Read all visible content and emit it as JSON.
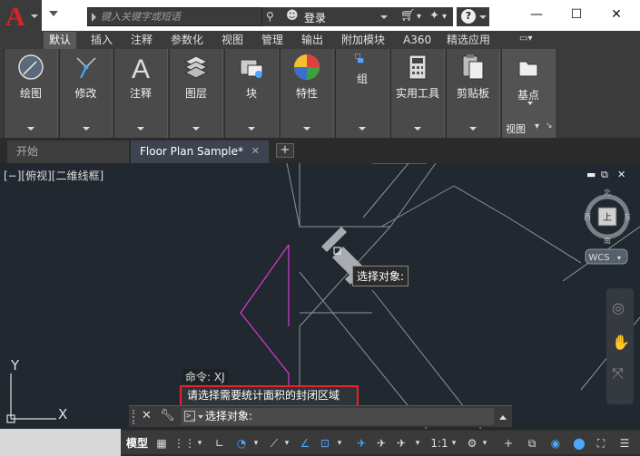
{
  "app": {
    "logo_letter": "A"
  },
  "search": {
    "placeholder": "键入关键字或短语"
  },
  "header": {
    "login_label": "登录"
  },
  "ribbon": {
    "tabs": [
      {
        "label": "默认",
        "active": true
      },
      {
        "label": "插入"
      },
      {
        "label": "注释"
      },
      {
        "label": "参数化"
      },
      {
        "label": "视图"
      },
      {
        "label": "管理"
      },
      {
        "label": "输出"
      },
      {
        "label": "附加模块"
      },
      {
        "label": "A360"
      },
      {
        "label": "精选应用"
      }
    ],
    "panels": [
      {
        "label": "绘图",
        "icon": "draw-icon"
      },
      {
        "label": "修改",
        "icon": "modify-icon"
      },
      {
        "label": "注释",
        "icon": "annotation-icon"
      },
      {
        "label": "图层",
        "icon": "layers-icon"
      },
      {
        "label": "块",
        "icon": "block-icon"
      },
      {
        "label": "特性",
        "icon": "properties-icon"
      },
      {
        "label": "组",
        "icon": "group-icon"
      },
      {
        "label": "实用工具",
        "icon": "calculator-icon"
      },
      {
        "label": "剪贴板",
        "icon": "clipboard-icon"
      },
      {
        "label": "基点",
        "icon": "basepoint-icon"
      }
    ],
    "view_label": "视图"
  },
  "doc_tabs": [
    {
      "label": "开始",
      "active": false
    },
    {
      "label": "Floor Plan Sample*",
      "active": true
    }
  ],
  "viewport": {
    "label": "[−][俯视][二维线框]",
    "viewcube_top": "上",
    "viewcube_west": "西",
    "viewcube_north": "北",
    "viewcube_east": "东",
    "viewcube_south": "南",
    "wcs_label": "WCS",
    "ucs_x": "X",
    "ucs_y": "Y"
  },
  "tooltip": {
    "text": "选择对象:"
  },
  "command": {
    "history_1": "命令: XJ",
    "history_2": "请选择需要统计面积的封闭区域",
    "prompt": "选择对象:"
  },
  "status": {
    "model_label": "模型",
    "scale_label": "1:1"
  },
  "colors": {
    "highlight_border": "#e8242a",
    "polyline_magenta": "#d63ad6",
    "drawing_bg": "#212830"
  }
}
